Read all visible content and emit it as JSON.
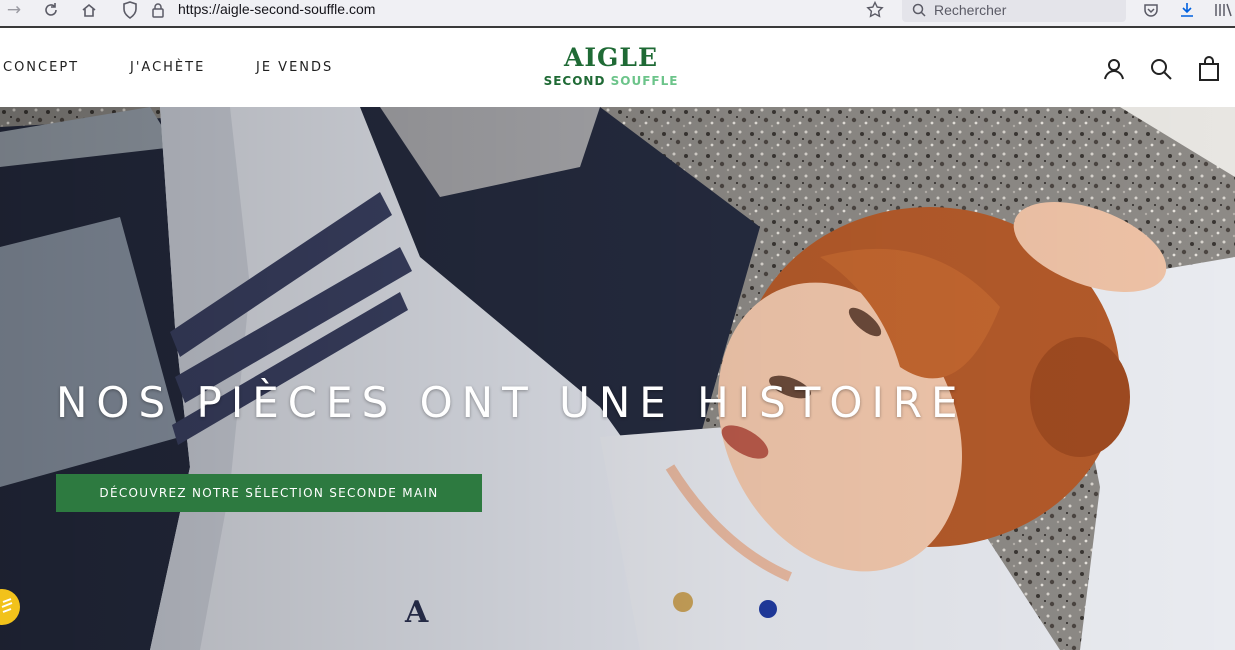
{
  "browser": {
    "url": "https://aigle-second-souffle.com",
    "search_placeholder": "Rechercher",
    "icons": [
      "back-icon",
      "reload-icon",
      "home-icon",
      "shield-icon",
      "lock-icon",
      "star-icon",
      "search-icon",
      "pocket-icon",
      "download-icon",
      "library-icon"
    ]
  },
  "header": {
    "nav": [
      {
        "label": "CONCEPT"
      },
      {
        "label": "J'ACHÈTE"
      },
      {
        "label": "JE VENDS"
      }
    ],
    "logo": {
      "main": "AIGLE",
      "sub_a": "SECOND",
      "sub_b": "SOUFFLE"
    },
    "icons": [
      "account-icon",
      "search-icon",
      "cart-icon"
    ]
  },
  "hero": {
    "title": "NOS PIÈCES ONT UNE HISTOIRE",
    "cta_label": "DÉCOUVREZ NOTRE SÉLECTION SECONDE MAIN"
  },
  "colors": {
    "brand_green": "#1f6a35",
    "brand_light_green": "#6cc48a",
    "cta_green": "#2d7a40",
    "badge_yellow": "#f2c21b"
  }
}
